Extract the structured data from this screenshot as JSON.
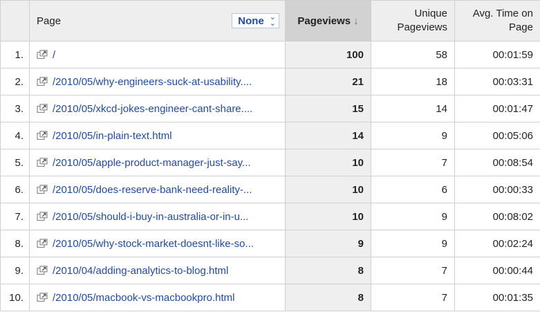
{
  "header": {
    "page_label": "Page",
    "dimension_select": "None",
    "pageviews": "Pageviews",
    "unique_pageviews_l1": "Unique",
    "unique_pageviews_l2": "Pageviews",
    "avg_time_l1": "Avg. Time on",
    "avg_time_l2": "Page"
  },
  "rows": [
    {
      "idx": "1.",
      "page": "/",
      "pageviews": "100",
      "unique": "58",
      "avg_time": "00:01:59"
    },
    {
      "idx": "2.",
      "page": "/2010/05/why-engineers-suck-at-usability....",
      "pageviews": "21",
      "unique": "18",
      "avg_time": "00:03:31"
    },
    {
      "idx": "3.",
      "page": "/2010/05/xkcd-jokes-engineer-cant-share....",
      "pageviews": "15",
      "unique": "14",
      "avg_time": "00:01:47"
    },
    {
      "idx": "4.",
      "page": "/2010/05/in-plain-text.html",
      "pageviews": "14",
      "unique": "9",
      "avg_time": "00:05:06"
    },
    {
      "idx": "5.",
      "page": "/2010/05/apple-product-manager-just-say...",
      "pageviews": "10",
      "unique": "7",
      "avg_time": "00:08:54"
    },
    {
      "idx": "6.",
      "page": "/2010/05/does-reserve-bank-need-reality-...",
      "pageviews": "10",
      "unique": "6",
      "avg_time": "00:00:33"
    },
    {
      "idx": "7.",
      "page": "/2010/05/should-i-buy-in-australia-or-in-u...",
      "pageviews": "10",
      "unique": "9",
      "avg_time": "00:08:02"
    },
    {
      "idx": "8.",
      "page": "/2010/05/why-stock-market-doesnt-like-so...",
      "pageviews": "9",
      "unique": "9",
      "avg_time": "00:02:24"
    },
    {
      "idx": "9.",
      "page": "/2010/04/adding-analytics-to-blog.html",
      "pageviews": "8",
      "unique": "7",
      "avg_time": "00:00:44"
    },
    {
      "idx": "10.",
      "page": "/2010/05/macbook-vs-macbookpro.html",
      "pageviews": "8",
      "unique": "7",
      "avg_time": "00:01:35"
    }
  ]
}
